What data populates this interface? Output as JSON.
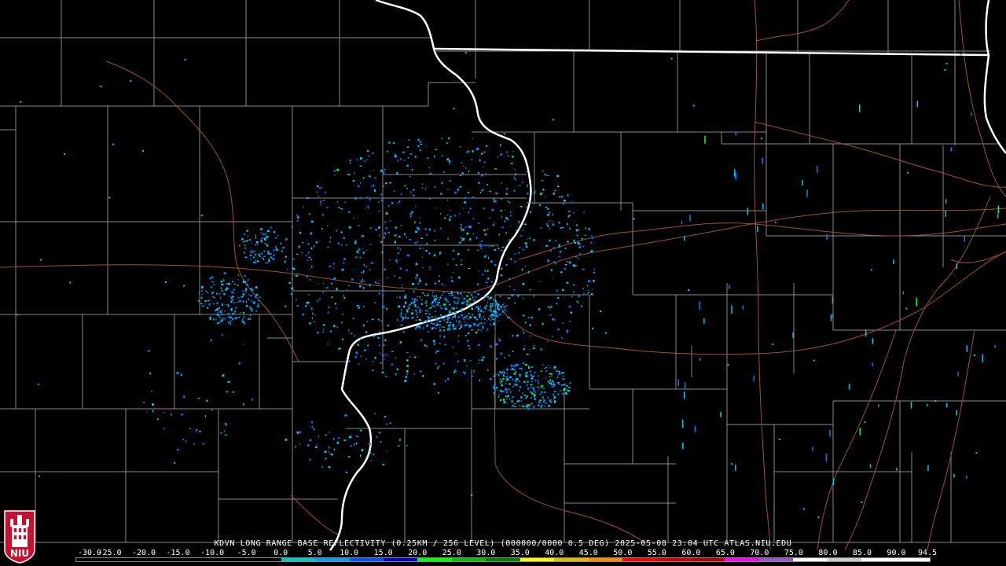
{
  "product": {
    "caption": "KDVN LONG RANGE BASE REFLECTIVITY (0.25KM / 256 LEVEL) (000000/0000 0.5 DEG) 2025-05-08 23:04 UTC  ATLAS.NIU.EDU"
  },
  "scale": {
    "labels": [
      "-30.0",
      "-25.0",
      "-20.0",
      "-15.0",
      "-10.0",
      "-5.0",
      "0.0",
      "5.0",
      "10.0",
      "15.0",
      "20.0",
      "25.0",
      "30.0",
      "35.0",
      "40.0",
      "45.0",
      "50.0",
      "55.0",
      "60.0",
      "65.0",
      "70.0",
      "75.0",
      "80.0",
      "85.0",
      "90.0",
      "94.5"
    ],
    "colors": [
      "#000000",
      "#000000",
      "#000000",
      "#000000",
      "#000000",
      "#000000",
      "#00c8c8",
      "#00a0f0",
      "#0050ff",
      "#0000c8",
      "#00ff00",
      "#00c000",
      "#008000",
      "#ffff00",
      "#e6b800",
      "#ff8c00",
      "#ff0000",
      "#d40000",
      "#b00000",
      "#ff00ff",
      "#9955cc",
      "#ffffff",
      "#cccccc",
      "#ffffff",
      "#ffffff"
    ]
  },
  "logo": {
    "text": "NIU",
    "colors": {
      "shield": "#c8102e",
      "tower": "#ffffff"
    }
  },
  "map_colors": {
    "background": "#000000",
    "county_lines": "#8a8a8a",
    "state_lines": "#ffffff",
    "highways": "#a0522d",
    "echo_light": "#00c8ff",
    "echo_mid": "#0080ff",
    "echo_green": "#00ff44"
  }
}
